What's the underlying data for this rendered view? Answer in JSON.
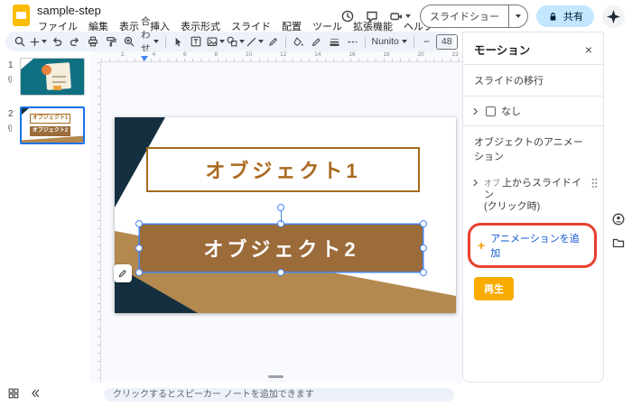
{
  "header": {
    "title": "sample-step",
    "menus": [
      "ファイル",
      "編集",
      "表示",
      "挿入",
      "表示形式",
      "スライド",
      "配置",
      "ツール",
      "拡張機能",
      "ヘルプ"
    ],
    "slideshow_label": "スライドショー",
    "share_label": "共有"
  },
  "toolbar": {
    "fit_label": "合わせる",
    "font_family": "Nunito",
    "font_size": "48",
    "minus": "−",
    "plus": "+"
  },
  "filmstrip": {
    "slide1_number": "1",
    "slide2_number": "2"
  },
  "objects": {
    "obj1": "オブジェクト1",
    "obj2": "オブジェクト2"
  },
  "canvas": {
    "ruler": [
      "2",
      "4",
      "6",
      "8",
      "10",
      "12",
      "14",
      "16",
      "18",
      "20",
      "22"
    ]
  },
  "motion": {
    "title": "モーション",
    "close": "×",
    "transition_section": "スライドの移行",
    "transition_value": "なし",
    "animations_section": "オブジェクトのアニメーション",
    "anim_prefix": "オブ",
    "anim_line1": "上からスライドイン",
    "anim_line2": "(クリック時)",
    "add_plus": "+",
    "add_label": "アニメーションを追加",
    "play_label": "再生"
  },
  "notes": {
    "placeholder": "クリックするとスピーカー ノートを追加できます"
  },
  "colors": {
    "accent": "#0b57d0",
    "toolbar_bg": "#edf2fa",
    "share_bg": "#c2e7ff",
    "share_text": "#001d35",
    "logo_yellow": "#fbbc04",
    "play_bg": "#f9ab00",
    "annotation_red": "#e8402f",
    "slide_navy": "#14303f",
    "slide_tan": "#b3894f",
    "object_brown": "#9c6b3a",
    "object_border": "#a9691e",
    "selection_blue": "#4285f4",
    "thumb_teal": "#0f7081"
  }
}
